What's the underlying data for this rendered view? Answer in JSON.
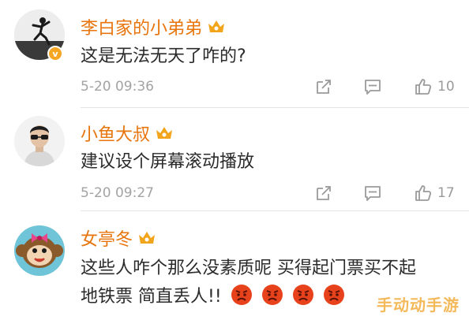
{
  "comments": [
    {
      "username": "李白家的小弟弟",
      "text": "这是无法无天了咋的?",
      "time": "5-20 09:36",
      "likes": "10",
      "verified": true
    },
    {
      "username": "小鱼大叔",
      "text": "建议设个屏幕滚动播放",
      "time": "5-20 09:27",
      "likes": "17",
      "verified": false
    },
    {
      "username": "女亭冬",
      "text_line1": "这些人咋个那么没素质呢 买得起门票买不起",
      "text_line2": "地铁票 简直丢人!!",
      "emoji": [
        "angry-face",
        "angry-face",
        "angry-face",
        "angry-face"
      ]
    }
  ],
  "watermark": "手动动手游",
  "colors": {
    "username": "#e8740c",
    "meta": "#a3a3a3",
    "crown": "#f2a51a",
    "watermark": "#f3b24a"
  },
  "icons": [
    "crown-badge-icon",
    "verified-badge-icon",
    "share-icon",
    "comment-icon",
    "like-icon",
    "angry-face-icon"
  ]
}
